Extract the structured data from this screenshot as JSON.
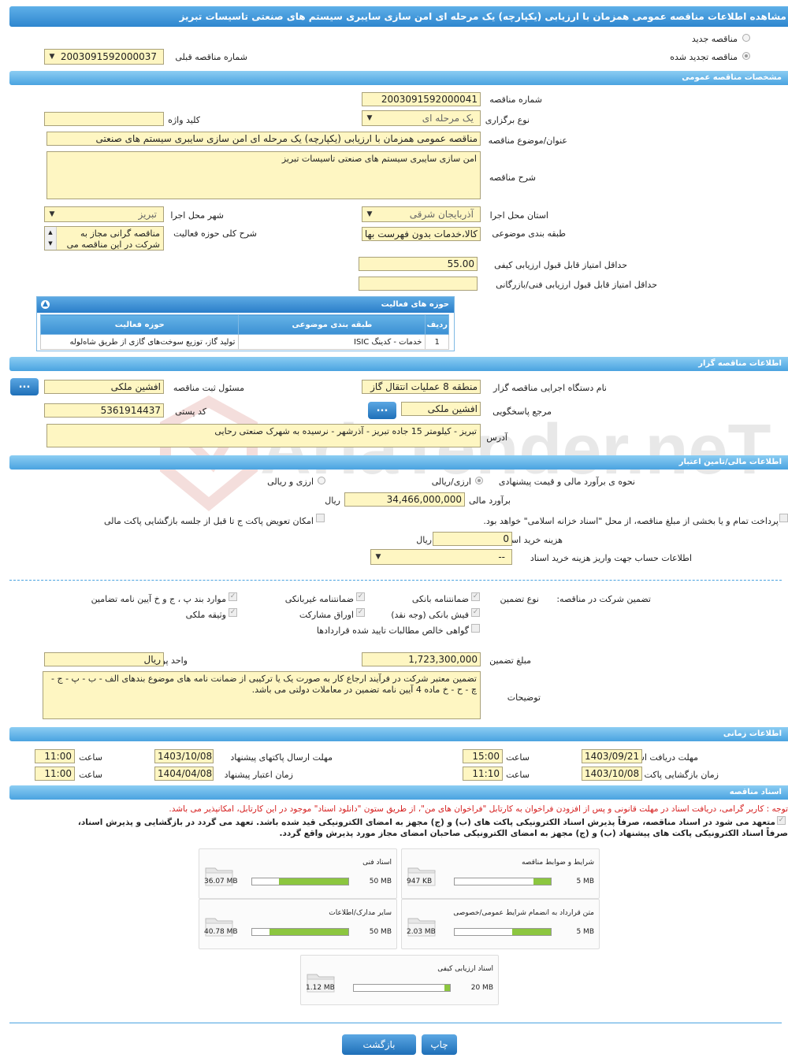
{
  "page_title": "مشاهده اطلاعات مناقصه عمومی همزمان با ارزیابی (یکپارچه) یک مرحله ای امن سازی سایبری سیستم های صنعتی تاسیسات تبریز",
  "watermark": "AriaTender.neT",
  "top": {
    "radio_new": "مناقصه جدید",
    "radio_renewed": "مناقصه تجدید شده",
    "prev_number_label": "شماره مناقصه قبلی",
    "prev_number_value": "2003091592000037"
  },
  "general": {
    "header": "مشخصات مناقصه عمومی",
    "number_label": "شماره مناقصه",
    "number_value": "2003091592000041",
    "holding_type_label": "نوع برگزاری",
    "holding_type_value": "یک مرحله ای",
    "keyword_label": "کلید واژه",
    "keyword_value": "",
    "subject_label": "عنوان/موضوع مناقصه",
    "subject_value": "مناقصه عمومی همزمان با ارزیابی (یکپارچه) یک مرحله ای امن سازی سایبری سیستم های صنعتی",
    "desc_label": "شرح مناقصه",
    "desc_value": "امن سازی سایبری سیستم های صنعتی تاسیسات تبریز",
    "province_label": "استان محل اجرا",
    "province_value": "آذربایجان شرقی",
    "city_label": "شهر محل اجرا",
    "city_value": "تبریز",
    "category_label": "طبقه بندی موضوعی",
    "category_value": "کالا،خدمات بدون فهرست بها",
    "activity_desc_label": "شرح کلی حوزه فعالیت",
    "activity_desc_value": "مناقصه گرانی مجاز به شرکت در این مناقصه می",
    "min_quality_label": "حداقل امتیاز قابل قبول ارزیابی کیفی",
    "min_quality_value": "55.00",
    "min_tech_label": "حداقل امتیاز قابل قبول ارزیابی فنی/بازرگانی",
    "min_tech_value": "",
    "activities": {
      "title": "حوزه های فعالیت",
      "headers": [
        "ردیف",
        "طبقه بندی موضوعی",
        "حوزه فعالیت"
      ],
      "rows": [
        [
          "1",
          "خدمات - کدینگ ISIC",
          "تولید گاز، توزیع سوخت‌های گازی از طریق شاه‌لوله"
        ]
      ]
    }
  },
  "organizer": {
    "header": "اطلاعات مناقصه گزار",
    "agency_label": "نام دستگاه اجرایی مناقصه گزار",
    "agency_value": "منطقه 8 عملیات انتقال گاز",
    "registrar_label": "مسئول ثبت مناقصه",
    "registrar_value": "افشین ملکی",
    "ref_label": "مرجع پاسخگویی",
    "ref_value": "افشین ملکی",
    "postal_label": "کد پستی",
    "postal_value": "5361914437",
    "address_label": "آدرس",
    "address_value": "تبریز - کیلومتر 15 جاده تبریز - آذرشهر - نرسیده به شهرک صنعتی رحایی",
    "dots": "..."
  },
  "finance": {
    "header": "اطلاعات مالی/تامین اعتبار",
    "method_label": "نحوه ی برآورد مالی و قیمت پیشنهادی",
    "opt_rial": "ارزی/ریالی",
    "opt_fx": "ارزی و ریالی",
    "estimate_label": "برآورد مالی",
    "estimate_value": "34,466,000,000",
    "rial": "ریال",
    "treasury_text": "پرداخت تمام و یا بخشی از مبلغ مناقصه، از محل \"اسناد خزانه اسلامی\" خواهد بود.",
    "swap_text": "امکان تعویض پاکت ج تا قبل از جلسه بازگشایی پاکت مالی",
    "doc_fee_label": "هزینه خرید اسناد",
    "doc_fee_value": "0",
    "account_label": "اطلاعات حساب جهت واریز هزینه خرید اسناد",
    "account_value": "--"
  },
  "guarantee": {
    "section_label": "تضمین شرکت در مناقصه:",
    "type_label": "نوع تضمین",
    "options": [
      "ضمانتنامه بانکی",
      "ضمانتنامه غیربانکی",
      "موارد بند پ ، ج و خ آیین نامه تضامین",
      "فیش بانکی (وجه نقد)",
      "اوراق مشارکت",
      "وثیقه ملکی",
      "گواهی خالص مطالبات تایید شده قراردادها"
    ],
    "amount_label": "مبلغ تضمین",
    "amount_value": "1,723,300,000",
    "currency_label": "واحد پول",
    "currency_value": "ریال",
    "notes_label": "توضیحات",
    "notes_value": "تضمین معتبر شرکت در فرآیند ارجاع کار به صورت یک یا ترکیبی از ضمانت نامه های موضوع بندهای الف - ب - پ - ج - چ - ح - خ ماده 4 آیین نامه تضمین در معاملات دولتی می باشد."
  },
  "timing": {
    "header": "اطلاعات زمانی",
    "doc_receive_label": "مهلت دریافت اسناد",
    "doc_receive_date": "1403/09/21",
    "doc_receive_time": "15:00",
    "submit_label": "مهلت ارسال پاکتهای پیشنهاد",
    "submit_date": "1403/10/08",
    "submit_time": "11:00",
    "opening_label": "زمان بازگشایی پاکت ها",
    "opening_date": "1403/10/08",
    "opening_time": "11:10",
    "validity_label": "زمان اعتبار پیشنهاد",
    "validity_date": "1404/04/08",
    "validity_time": "11:00",
    "time_label": "ساعت"
  },
  "docs": {
    "header": "اسناد مناقصه",
    "notice": "توجه : کاربر گرامی، دریافت اسناد در مهلت قانونی و پس از افزودن فراخوان به کارتابل \"فراخوان های من\"، از طریق ستون \"دانلود اسناد\" موجود در این کارتابل، امکانپذیر می باشد.",
    "commit_line1": "متعهد می شود در اسناد مناقصه، صرفاً پذیرش اسناد الکترونیکی پاکت های (ب) و (ج) مجهز به امضای الکترونیکی قید شده باشد. تعهد می گردد در بازگشایی و پذیرش اسناد،",
    "commit_line2": "صرفاً اسناد الکترونیکی پاکت های پیشنهاد (ب) و (ج) مجهز به امضای الکترونیکی صاحبان امضای مجاز مورد پذیرش واقع گردد.",
    "cards": [
      {
        "name": "شرایط و ضوابط مناقصه",
        "used": "947 KB",
        "max": "5 MB",
        "pct": 18
      },
      {
        "name": "اسناد فنی",
        "used": "36.07 MB",
        "max": "50 MB",
        "pct": 72
      },
      {
        "name": "متن قرارداد به انضمام شرایط عمومی/خصوصی",
        "used": "2.03 MB",
        "max": "5 MB",
        "pct": 40
      },
      {
        "name": "سایر مدارک/اطلاعات",
        "used": "40.78 MB",
        "max": "50 MB",
        "pct": 82
      },
      {
        "name": "اسناد ارزیابی کیفی",
        "used": "1.12 MB",
        "max": "20 MB",
        "pct": 6
      }
    ]
  },
  "footer": {
    "print": "چاپ",
    "back": "بازگشت"
  }
}
